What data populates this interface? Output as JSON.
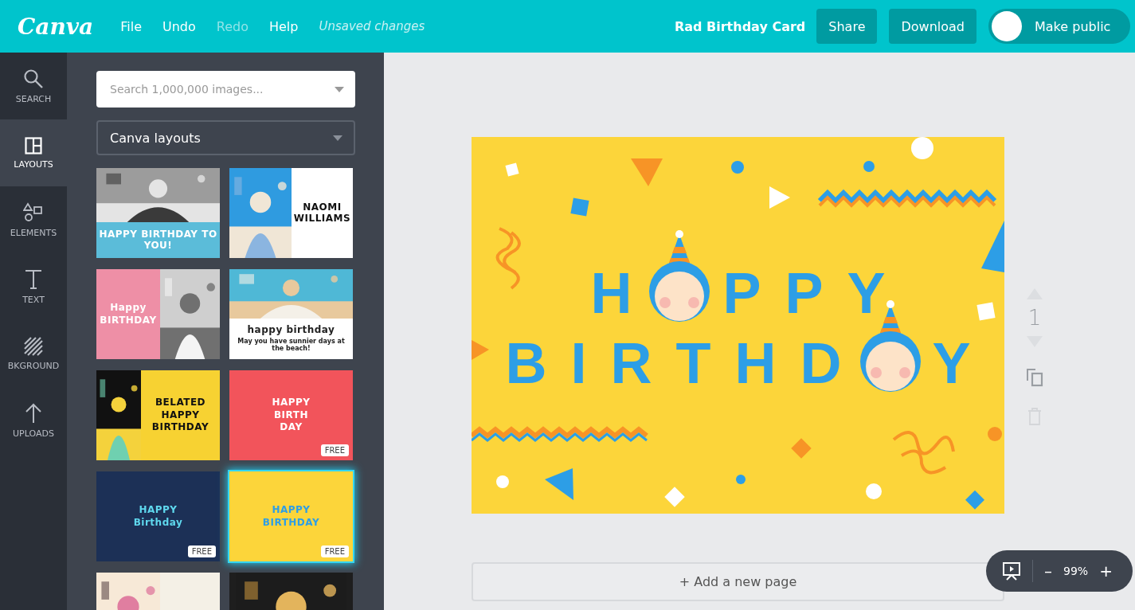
{
  "topbar": {
    "logo": "Canva",
    "menu": [
      {
        "label": "File",
        "disabled": false
      },
      {
        "label": "Undo",
        "disabled": false
      },
      {
        "label": "Redo",
        "disabled": true
      },
      {
        "label": "Help",
        "disabled": false
      }
    ],
    "status": "Unsaved changes",
    "title": "Rad Birthday Card",
    "buttons": [
      "Share",
      "Download"
    ],
    "public_toggle": {
      "label": "Make public",
      "on": false
    }
  },
  "rail": [
    {
      "label": "SEARCH",
      "selected": false
    },
    {
      "label": "LAYOUTS",
      "selected": true
    },
    {
      "label": "ELEMENTS",
      "selected": false
    },
    {
      "label": "TEXT",
      "selected": false
    },
    {
      "label": "BKGROUND",
      "selected": false
    },
    {
      "label": "UPLOADS",
      "selected": false
    }
  ],
  "panel": {
    "search": {
      "placeholder": "Search 1,000,000 images..."
    },
    "category": "Canva layouts",
    "layouts": [
      {
        "kind": "photo-band",
        "texts": [
          {
            "kind": "heading",
            "text": "HAPPY BIRTHDAY TO YOU!"
          }
        ],
        "selected": false
      },
      {
        "kind": "photo-side",
        "texts": [
          {
            "kind": "heading",
            "text": "NAOMI WILLIAMS"
          }
        ],
        "selected": false
      },
      {
        "kind": "photo-pink",
        "texts": [
          {
            "kind": "heading",
            "text": "Happy"
          },
          {
            "kind": "heading",
            "text": "BIRTHDAY"
          }
        ],
        "selected": false
      },
      {
        "kind": "photo-beach",
        "texts": [
          {
            "kind": "heading",
            "text": "happy birthday"
          },
          {
            "kind": "caption",
            "text": "May you have sunnier days at the beach!"
          }
        ],
        "selected": false
      },
      {
        "kind": "confetti-side",
        "texts": [
          {
            "kind": "heading",
            "text": "BELATED"
          },
          {
            "kind": "heading",
            "text": "HAPPY"
          },
          {
            "kind": "heading",
            "text": "BIRTHDAY"
          }
        ],
        "selected": false
      },
      {
        "kind": "retro",
        "texts": [
          {
            "kind": "heading",
            "text": "HAPPY"
          },
          {
            "kind": "heading",
            "text": "BIRTH"
          },
          {
            "kind": "heading",
            "text": "DAY"
          }
        ],
        "badge": "FREE",
        "selected": false
      },
      {
        "kind": "navy",
        "texts": [
          {
            "kind": "heading",
            "text": "HAPPY"
          },
          {
            "kind": "heading",
            "text": "Birthday"
          }
        ],
        "badge": "FREE",
        "selected": false
      },
      {
        "kind": "party",
        "texts": [
          {
            "kind": "heading",
            "text": "HAPPY"
          },
          {
            "kind": "heading",
            "text": "BIRTHDAY"
          }
        ],
        "badge": "FREE",
        "selected": true
      },
      {
        "kind": "donut",
        "selected": false
      },
      {
        "kind": "flower",
        "selected": false
      }
    ]
  },
  "design": {
    "lines": [
      {
        "before": "H",
        "after": "PPY"
      },
      {
        "before": "BIRTHD",
        "after": "Y"
      }
    ]
  },
  "page_controls": {
    "page_number": "1"
  },
  "add_page": "+ Add a new page",
  "zoom": {
    "minus": "–",
    "value": "99%",
    "plus": "+"
  }
}
